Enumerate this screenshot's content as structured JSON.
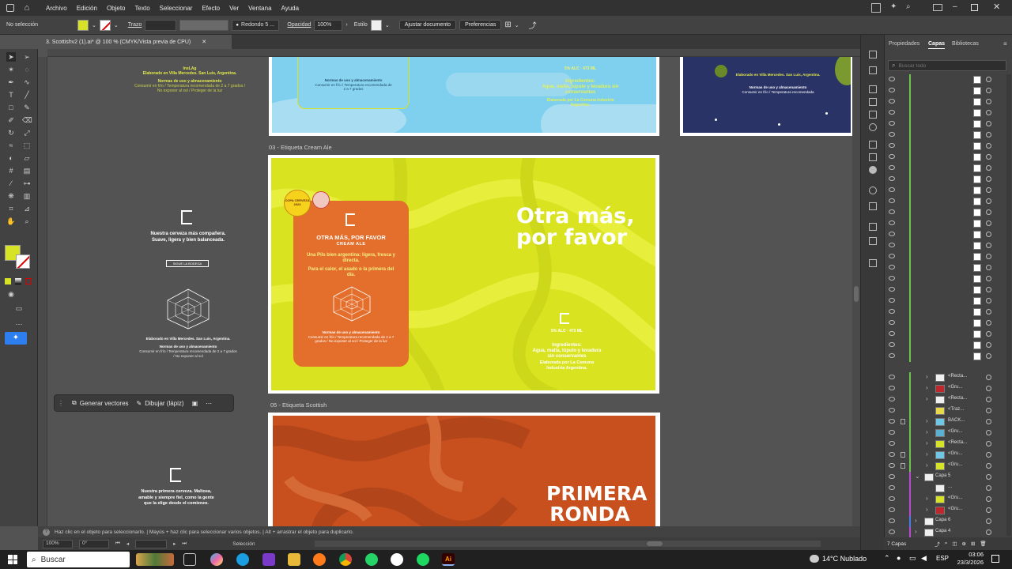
{
  "menu": {
    "items": [
      "Archivo",
      "Edición",
      "Objeto",
      "Texto",
      "Seleccionar",
      "Efecto",
      "Ver",
      "Ventana",
      "Ayuda"
    ]
  },
  "control": {
    "selection": "No selección",
    "stroke_label": "Trazo",
    "brush": "Redondo 5 ...",
    "opacity_label": "Opacidad",
    "opacity": "100%",
    "style_label": "Estilo",
    "adjust_doc": "Ajustar documento",
    "preferences": "Preferencias"
  },
  "doc": {
    "tab_title": "3. Scottishv2 (1).ai* @ 100 % (CMYK/Vista previa de CPU)"
  },
  "artboards": {
    "cream_ale_label": "03 - Etiqueta Cream Ale",
    "scottish_label": "05 - Etiqueta Scottish",
    "cream_big_1": "Otra más,",
    "cream_big_2": "por favor",
    "cream_card_title": "OTRA MÁS, POR FAVOR",
    "cream_card_sub": "CREAM ALE",
    "cream_card_body": "Una Pils bien argentina: ligera, fresca y directa.",
    "cream_card_body2": "Para el calor, el asado o la primera del día.",
    "cream_card_norms": "Normas de uso y almacenamiento",
    "ingredients_title": "Ingredientes:",
    "ingredients": "Agua, malta, lúpulo y levadura sin conservantes",
    "elaborado": "Elaborada por La Comuna Industria Argentina.",
    "abv": "5% ALC  ·  473 ML",
    "copa_badge": "COPA CERVEZA 2023",
    "scottish_big_1": "PRIMERA",
    "scottish_big_2": "RONDA",
    "left_label_1": "Nuestra cerveza más compañera. Suave, ligera y bien balanceada.",
    "left_label_2": "Nuestra primera cerveza. Maltosa, amable y siempre fiel, como la gente que la elige desde el comienzo.",
    "left_elaborado": "Elaborado en Villa Mercedes. San Luis, Argentina.",
    "left_norms": "Normas de uso y almacenamiento",
    "bodega": "SIGUE LA BODEGA"
  },
  "ctx": {
    "generate": "Generar vectores",
    "draw": "Dibujar (lápiz)"
  },
  "status": {
    "text": "Haz clic en el objeto para seleccionarlo.  |  Mayús + haz clic para seleccionar varios objetos.  |  Alt + arrastrar el objeto para duplicarlo."
  },
  "nav": {
    "zoom": "100%",
    "rotation": "0°",
    "mode": "Selección"
  },
  "panels": {
    "tabs": [
      "Propiedades",
      "Capas",
      "Bibliotecas"
    ],
    "active_tab": "Capas",
    "search_placeholder": "Buscar todo",
    "layers_count": "7 Capas"
  },
  "layers": [
    {
      "name": "<Recta...",
      "color": "#f0f0f0",
      "chevron": "›",
      "bar": "#6cc24a",
      "lock": false
    },
    {
      "name": "<Gru...",
      "color": "#c0272d",
      "chevron": "›",
      "bar": "#6cc24a",
      "lock": false
    },
    {
      "name": "<Recta...",
      "color": "#f0f0f0",
      "chevron": "›",
      "bar": "#6cc24a",
      "lock": false
    },
    {
      "name": "<Traz...",
      "color": "#e8d84a",
      "chevron": "",
      "bar": "#6cc24a",
      "lock": false
    },
    {
      "name": "BACK...",
      "color": "#6fc6e6",
      "chevron": "›",
      "bar": "#6cc24a",
      "lock": true
    },
    {
      "name": "<Gru...",
      "color": "#5ab0d0",
      "chevron": "›",
      "bar": "#6cc24a",
      "lock": false
    },
    {
      "name": "<Recta...",
      "color": "#d7e326",
      "chevron": "›",
      "bar": "#6cc24a",
      "lock": false
    },
    {
      "name": "<Gru...",
      "color": "#6fc6e6",
      "chevron": "›",
      "bar": "#6cc24a",
      "lock": true
    },
    {
      "name": "<Gru...",
      "color": "#d7e326",
      "chevron": "›",
      "bar": "#6cc24a",
      "lock": true
    },
    {
      "name": "Capa 5",
      "color": "#f0f0f0",
      "chevron": "⌄",
      "bar": "#b84ad0",
      "lock": false
    },
    {
      "name": "...",
      "color": "#f0f0f0",
      "chevron": "",
      "bar": "#b84ad0",
      "lock": false
    },
    {
      "name": "<Gru...",
      "color": "#d7e326",
      "chevron": "›",
      "bar": "#b84ad0",
      "lock": false
    },
    {
      "name": "<Gru...",
      "color": "#c0272d",
      "chevron": "›",
      "bar": "#b84ad0",
      "lock": false
    },
    {
      "name": "Capa 6",
      "color": "#f0f0f0",
      "chevron": "›",
      "bar": "#4a7be0",
      "lock": false
    },
    {
      "name": "Capa 4",
      "color": "#f0f0f0",
      "chevron": "›",
      "bar": "#b84ad0",
      "lock": false
    }
  ],
  "taskbar": {
    "search": "Buscar",
    "weather": "14°C  Nublado",
    "lang": "ESP",
    "time": "03:06",
    "date": "23/3/2026"
  },
  "colors": {
    "cream_bg": "#d9e31f",
    "cream_card": "#e46f2d",
    "scottish_bg": "#c8501e",
    "sky": "#7fd0ee",
    "night": "#2a3366",
    "fill_swatch": "#d7e326"
  }
}
